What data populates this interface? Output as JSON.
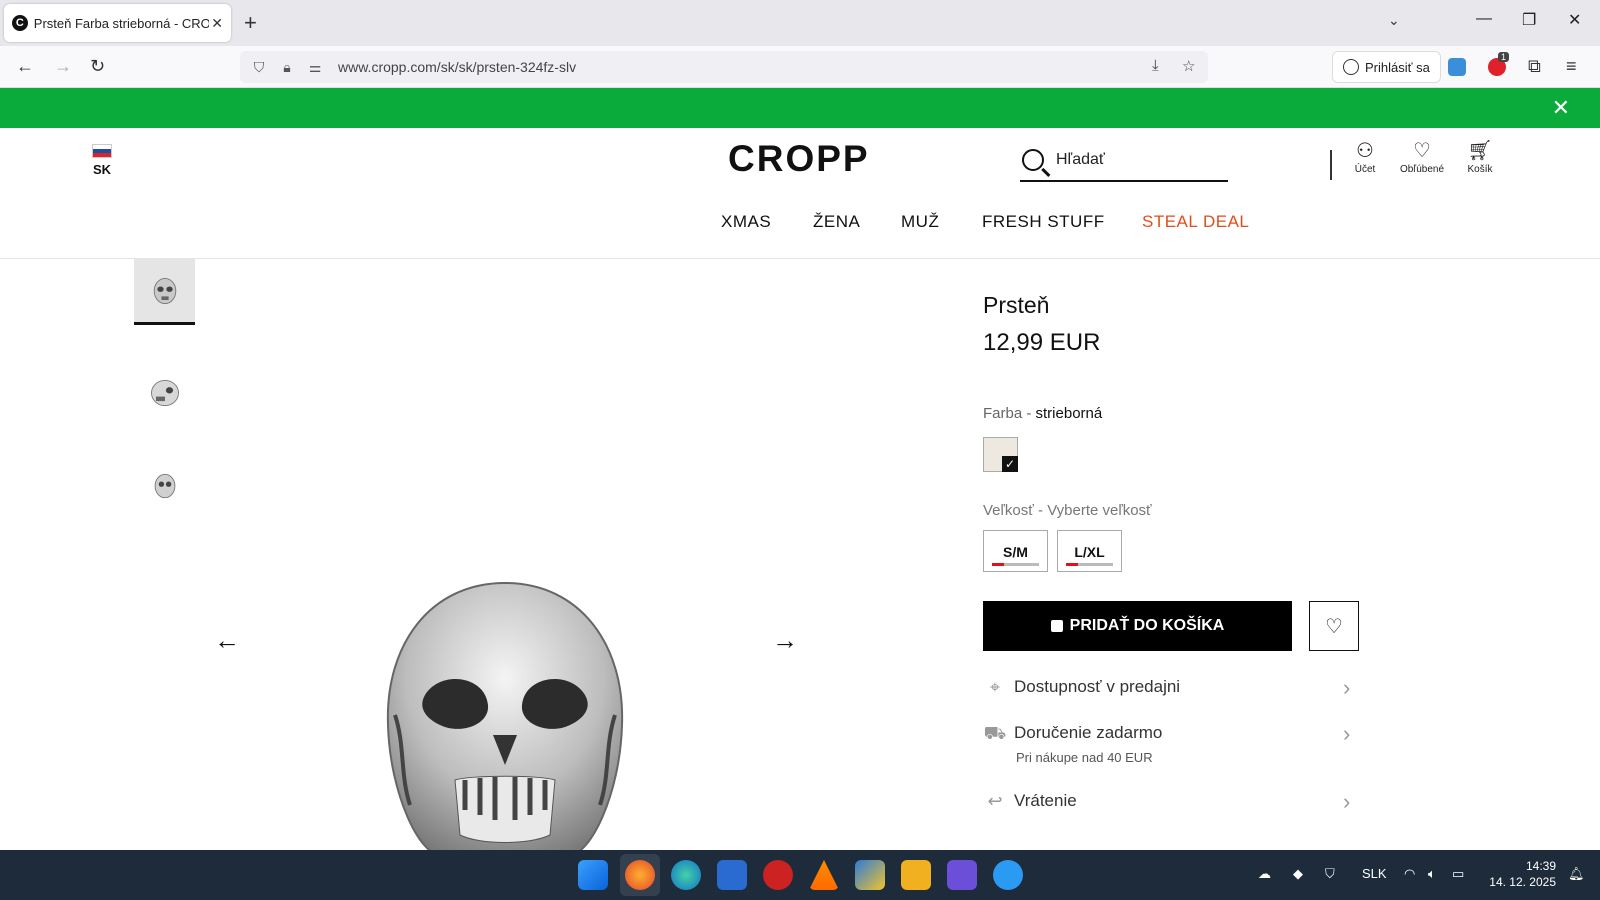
{
  "browser": {
    "tab_title": "Prsteň Farba strieborná - CROPP",
    "tab_favicon": "C",
    "new_tab": "+",
    "url": "www.cropp.com/sk/sk/prsten-324fz-slv",
    "signin_label": "Prihlásiť sa",
    "ext_badge": "1",
    "icons": [
      "back-icon",
      "forward-icon",
      "reload-icon",
      "shield-icon",
      "lock-icon",
      "permissions-icon",
      "save-page-icon",
      "bookmark-star-icon",
      "account-icon",
      "extension-icon",
      "menu-icon"
    ]
  },
  "banner": {
    "color": "#0aab3b",
    "close": "✕"
  },
  "header": {
    "country_code": "SK",
    "logo": "CROPP",
    "search_placeholder": "Hľadať",
    "account": "Účet",
    "favorites": "Obľúbené",
    "cart": "Košík"
  },
  "nav": {
    "items": [
      "XMAS",
      "ŽENA",
      "MUŽ",
      "FRESH STUFF",
      "STEAL DEAL"
    ],
    "highlight_color": "#e04e1c"
  },
  "product": {
    "title": "Prsteň",
    "price": "12,99 EUR",
    "color_label": "Farba - ",
    "color_value": "strieborná",
    "size_label": "Veľkosť - Vyberte veľkosť",
    "sizes": [
      {
        "label": "S/M",
        "stock_level": 0.25
      },
      {
        "label": "L/XL",
        "stock_level": 0.25
      }
    ],
    "add_to_cart": "PRIDAŤ DO KOŠÍKA",
    "availability": "Dostupnosť v predajni",
    "delivery": "Doručenie zadarmo",
    "delivery_note": "Pri nákupe nad 40 EUR",
    "returns": "Vrátenie"
  },
  "taskbar": {
    "language": "SLK",
    "time": "14:39",
    "date": "14. 12. 2025"
  }
}
